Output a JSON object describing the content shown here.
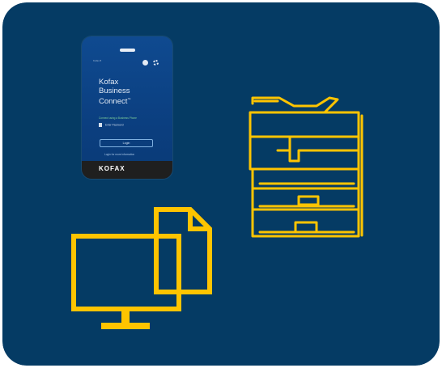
{
  "colors": {
    "background": "#053b64",
    "line_art": "#ffc400",
    "phone_body": "#0f4a90",
    "phone_footer": "#1f1f1f"
  },
  "phone": {
    "status_text": "Kofax 8",
    "app_title_line1": "Kofax",
    "app_title_line2": "Business",
    "app_title_line3": "Connect",
    "app_title_mark": "™",
    "prompt_text": "Connect using a Business Phone",
    "user_option_text": "Enter Password",
    "login_label": "Login",
    "link_text": "Login for more information",
    "brand_text": "KOFAX",
    "icons": [
      "help-icon",
      "settings-icon",
      "user-icon"
    ]
  },
  "illustrations": [
    "printer-icon",
    "monitor-icon",
    "document-icon"
  ]
}
